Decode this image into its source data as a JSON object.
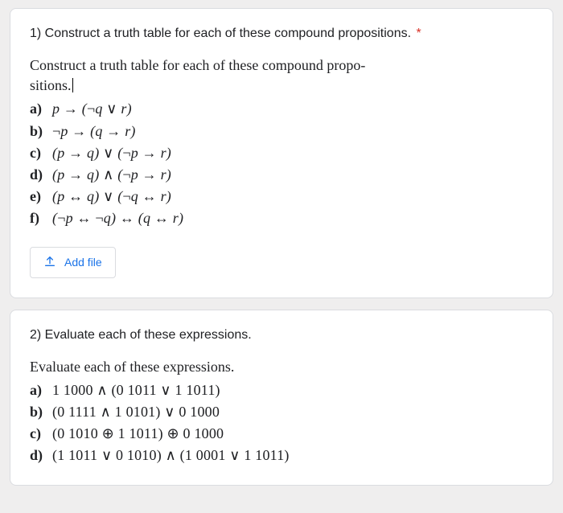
{
  "q1": {
    "title": "1) Construct a truth table for each of these compound propositions.",
    "asterisk": "*",
    "lead_line1": "Construct a truth table for each of these compound propo-",
    "lead_line2": "sitions.",
    "items": [
      {
        "label": "a)",
        "expr_html": "<i>p</i> <span class='op'>→</span> (<span class='op'>¬</span><i>q</i> <span class='op'>∨</span> <i>r</i>)"
      },
      {
        "label": "b)",
        "expr_html": "<span class='op'>¬</span><i>p</i> <span class='op'>→</span> (<i>q</i> <span class='op'>→</span> <i>r</i>)"
      },
      {
        "label": "c)",
        "expr_html": "(<i>p</i> <span class='op'>→</span> <i>q</i>) <span class='op'>∨</span> (<span class='op'>¬</span><i>p</i> <span class='op'>→</span> <i>r</i>)"
      },
      {
        "label": "d)",
        "expr_html": "(<i>p</i> <span class='op'>→</span> <i>q</i>) <span class='op'>∧</span> (<span class='op'>¬</span><i>p</i> <span class='op'>→</span> <i>r</i>)"
      },
      {
        "label": "e)",
        "expr_html": "(<i>p</i> <span class='op'>↔</span> <i>q</i>) <span class='op'>∨</span> (<span class='op'>¬</span><i>q</i> <span class='op'>↔</span> <i>r</i>)"
      },
      {
        "label": "f)",
        "expr_html": "(<span class='op'>¬</span><i>p</i> <span class='op'>↔</span> <span class='op'>¬</span><i>q</i>) <span class='op'>↔</span> (<i>q</i> <span class='op'>↔</span> <i>r</i>)"
      }
    ],
    "add_file_label": "Add file"
  },
  "q2": {
    "title": "2) Evaluate each of these expressions.",
    "lead": "Evaluate each of these expressions.",
    "items": [
      {
        "label": "a)",
        "expr_html": "1 1000 <span class='op'>∧</span> (0 1011 <span class='op'>∨</span> 1 1011)"
      },
      {
        "label": "b)",
        "expr_html": "(0 1111 <span class='op'>∧</span> 1 0101) <span class='op'>∨</span> 0 1000"
      },
      {
        "label": "c)",
        "expr_html": "(0 1010 <span class='op'>⊕</span> 1 1011) <span class='op'>⊕</span> 0 1000"
      },
      {
        "label": "d)",
        "expr_html": "(1 1011 <span class='op'>∨</span> 0 1010) <span class='op'>∧</span> (1 0001 <span class='op'>∨</span> 1 1011)"
      }
    ]
  }
}
